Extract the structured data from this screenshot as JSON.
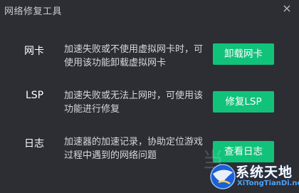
{
  "window": {
    "title": "网络修复工具",
    "close_glyph": "×"
  },
  "rows": [
    {
      "name": "网卡",
      "desc": "加速失败或不使用虚拟网卡时，可使用该功能卸载虚拟网卡",
      "button": "卸载网卡"
    },
    {
      "name": "LSP",
      "desc": "加速失败或无法上网时，可使用该功能进行修复",
      "button": "修复LSP"
    },
    {
      "name": "日志",
      "desc": "加速器的加速记录，协助定位游戏过程中遇到的网络问题",
      "button": "查看日志"
    }
  ],
  "watermark": {
    "faded_text": "当",
    "logo_cn": "系统天地",
    "logo_en": "XiTongTianDi.net"
  },
  "colors": {
    "background": "#2c2e33",
    "button": "#10c27a",
    "text": "#d5d7db"
  }
}
